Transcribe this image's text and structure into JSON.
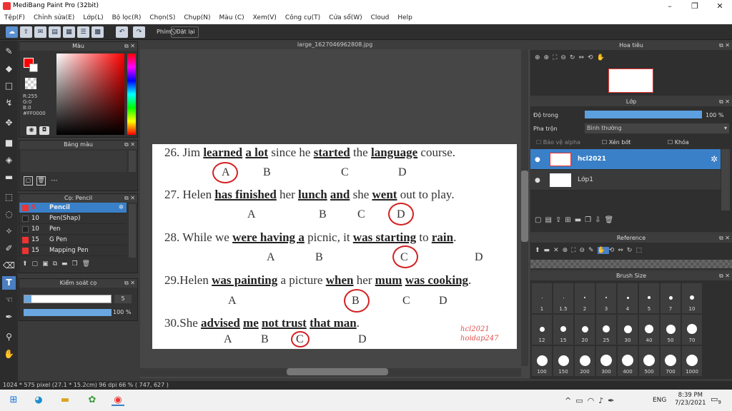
{
  "window": {
    "title": "MediBang Paint Pro (32bit)",
    "min": "–",
    "max": "❐",
    "close": "✕"
  },
  "menu": [
    "Tệp(F)",
    "Chỉnh sửa(E)",
    "Lớp(L)",
    "Bộ lọc(R)",
    "Chọn(S)",
    "Chụp(N)",
    "Màu (C)",
    "Xem(V)",
    "Công cụ(T)",
    "Cửa sổ(W)",
    "Cloud",
    "Help"
  ],
  "toolbar": {
    "phim": "Phím",
    "reset": "Đặt lại"
  },
  "color_panel": {
    "title": "Màu",
    "r": "R:255",
    "g": "G:0",
    "b": "B:0",
    "hex": "#FF0000"
  },
  "palette_panel": {
    "title": "Bảng màu",
    "dash": "---"
  },
  "brush_panel": {
    "title": "Cọ: Pencil",
    "items": [
      {
        "size": "5",
        "name": "Pencil",
        "color": "#e33"
      },
      {
        "size": "10",
        "name": "Pen(Shap)",
        "color": "#222"
      },
      {
        "size": "10",
        "name": "Pen",
        "color": "#222"
      },
      {
        "size": "15",
        "name": "G Pen",
        "color": "#e33"
      },
      {
        "size": "15",
        "name": "Mapping Pen",
        "color": "#e33"
      }
    ]
  },
  "brush_control": {
    "title": "Kiểm soát cọ",
    "size": "5",
    "opacity": "100 %"
  },
  "canvas": {
    "tab": "large_1627046962808.jpg"
  },
  "document": {
    "q26": {
      "num": "26. Jim ",
      "w1": "learned",
      "s1": " ",
      "w2": "a lot",
      "s2": " since he ",
      "w3": "started",
      "s3": " the ",
      "w4": "language",
      "s4": " course.",
      "opts": [
        "A",
        "B",
        "C",
        "D"
      ]
    },
    "q27": {
      "num": "27. Helen ",
      "w1": "has finished",
      "s1": " her ",
      "w2": "lunch",
      "s2": " ",
      "w3": "and",
      "s3": " she ",
      "w4": "went",
      "s4": " out to play.",
      "opts": [
        "A",
        "B",
        "C",
        "D"
      ]
    },
    "q28": {
      "num": "28. While we ",
      "w1": "were having ",
      "s1": " ",
      "w2": "a",
      "s2": " picnic, it ",
      "w3": "was starting",
      "s3": " to ",
      "w4": "rain",
      "s4": ".",
      "opts": [
        "A",
        "B",
        "C",
        "D"
      ]
    },
    "q29": {
      "num": "29.Helen ",
      "w1": "was painting",
      "s1": " a picture ",
      "w2": "when",
      "s2": " her ",
      "w3": "mum",
      "s3": " ",
      "w4": "was cooking",
      "s4": ".",
      "opts": [
        "A",
        "B",
        "C",
        "D"
      ]
    },
    "q30": {
      "num": "30.She ",
      "w1": "advised",
      "s1": " ",
      "w2": "me",
      "s2": " ",
      "w3": "not trust",
      "s3": "  ",
      "w4": "that man",
      "s4": ".",
      "opts": [
        "A",
        "B",
        "C",
        "D"
      ]
    },
    "watermark1": "hcl2021",
    "watermark2": "hoidap247"
  },
  "navigator": {
    "title": "Hoa tiêu"
  },
  "layer_panel": {
    "title": "Lớp",
    "opacity_label": "Độ trong",
    "opacity_value": "100 %",
    "blend_label": "Pha trộn",
    "blend_value": "Bình thường",
    "protect_alpha": "Bảo vệ alpha",
    "clipping": "Xén bớt",
    "lock": "Khóa",
    "layers": [
      "hcl2021",
      "Lớp1"
    ]
  },
  "reference": {
    "title": "Reference"
  },
  "brush_size": {
    "title": "Brush Size",
    "sizes": [
      "1",
      "1.5",
      "2",
      "3",
      "4",
      "5",
      "7",
      "10",
      "12",
      "15",
      "20",
      "25",
      "30",
      "40",
      "50",
      "70",
      "100",
      "150",
      "200",
      "300",
      "400",
      "500",
      "700",
      "1000"
    ]
  },
  "status": {
    "text": "1024 * 575 pixel  (27.1 * 15.2cm)  96 dpi  66 %  ( 747, 627 )"
  },
  "taskbar": {
    "lang": "ENG",
    "time": "8:39 PM",
    "date": "7/23/2021",
    "notif": "9"
  },
  "colors": {
    "accent": "#4a90d9",
    "red": "#ff0000",
    "selection": "#3a80c8"
  }
}
